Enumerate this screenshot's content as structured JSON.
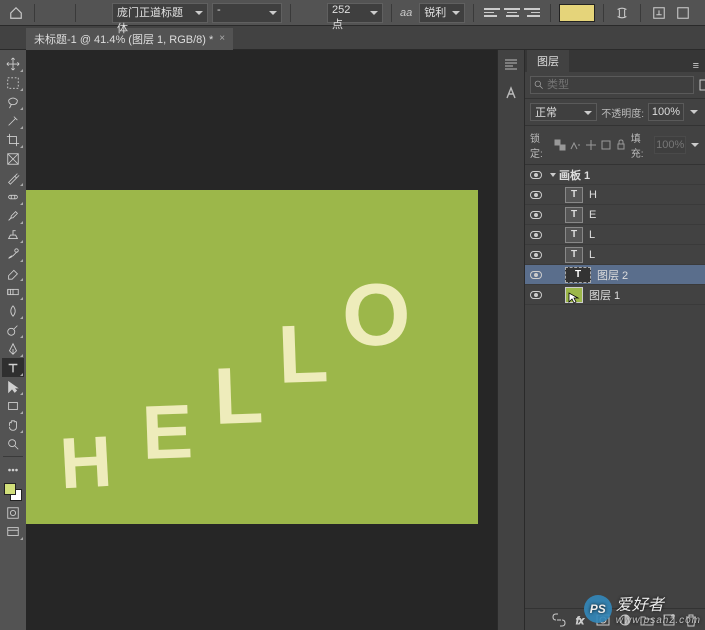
{
  "options_bar": {
    "font_family": "庞门正道标题体",
    "font_style": "-",
    "size_value": "252 点",
    "aa_label": "aa",
    "aa_value": "锐利",
    "color_swatch": "#e5d47a"
  },
  "document_tab": {
    "title": "未标题-1 @ 41.4% (图层 1, RGB/8) *"
  },
  "canvas": {
    "bg": "#9cb74a",
    "letters": [
      "H",
      "E",
      "L",
      "L",
      "O"
    ],
    "letter_color": "#eeecbb"
  },
  "layers_panel": {
    "tab": "图层",
    "filter_placeholder": "类型",
    "blend_mode": "正常",
    "opacity_label": "不透明度:",
    "opacity_value": "100%",
    "lock_label": "锁定:",
    "fill_label": "填充:",
    "fill_value": "100%",
    "artboard": "画板 1",
    "layers": [
      {
        "type": "text",
        "name": "H"
      },
      {
        "type": "text",
        "name": "E"
      },
      {
        "type": "text",
        "name": "L"
      },
      {
        "type": "text",
        "name": "L"
      },
      {
        "type": "text",
        "name": "图层 2",
        "selected": true,
        "bigthumb": true
      },
      {
        "type": "fill",
        "name": "图层 1",
        "green": true
      }
    ]
  },
  "watermark": {
    "logo": "PS",
    "text": "爱好者",
    "sub": "www.psahz.com"
  }
}
